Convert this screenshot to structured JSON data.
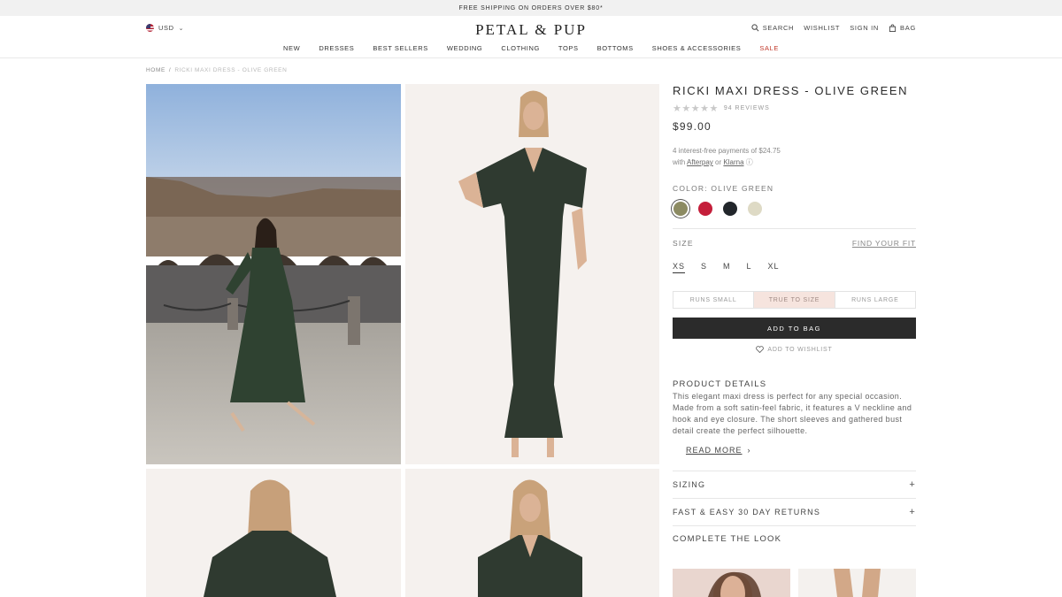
{
  "promo": "FREE SHIPPING ON ORDERS OVER $80*",
  "header": {
    "currency": "USD",
    "logo": "PETAL & PUP",
    "util": [
      {
        "label": "SEARCH",
        "icon": "search-icon"
      },
      {
        "label": "WISHLIST"
      },
      {
        "label": "SIGN IN"
      },
      {
        "label": "BAG",
        "icon": "bag-icon"
      }
    ]
  },
  "nav": [
    "NEW",
    "DRESSES",
    "BEST SELLERS",
    "WEDDING",
    "CLOTHING",
    "TOPS",
    "BOTTOMS",
    "SHOES & ACCESSORIES",
    "SALE"
  ],
  "breadcrumb": {
    "home": "HOME",
    "sep": "/",
    "current": "RICKI MAXI DRESS - OLIVE GREEN"
  },
  "product": {
    "title": "RICKI MAXI DRESS - OLIVE GREEN",
    "stars": "★★★★★",
    "reviews": "94 REVIEWS",
    "price": "$99.00",
    "afterpay_line1": "4 interest-free payments of $24.75",
    "afterpay_with": "with",
    "afterpay_name": "Afterpay",
    "afterpay_or": "or",
    "klarna_name": "Klarna",
    "info_icon": "ⓘ",
    "color_label": "COLOR: OLIVE GREEN",
    "swatches": [
      "#8c8b62",
      "#c41e3a",
      "#22262b",
      "#dedac5"
    ],
    "size_label": "SIZE",
    "find_fit": "FIND YOUR FIT",
    "sizes": [
      "XS",
      "S",
      "M",
      "L",
      "XL"
    ],
    "fit": [
      "RUNS SMALL",
      "TRUE TO SIZE",
      "RUNS LARGE"
    ],
    "add_to_bag": "ADD TO BAG",
    "wishlist": "ADD TO WISHLIST",
    "details_title": "PRODUCT DETAILS",
    "details_text": "This elegant maxi dress is perfect for any special occasion. Made from a soft satin-feel fabric, it features a V neckline and hook and eye closure. The short sleeves and gathered bust detail create the perfect silhouette.",
    "read_more": "READ MORE",
    "read_more_arrow": "›",
    "accordions": [
      {
        "label": "SIZING",
        "icon": "+"
      },
      {
        "label": "FAST & EASY 30 DAY RETURNS",
        "icon": "+"
      }
    ],
    "complete_look": "COMPLETE THE LOOK"
  }
}
